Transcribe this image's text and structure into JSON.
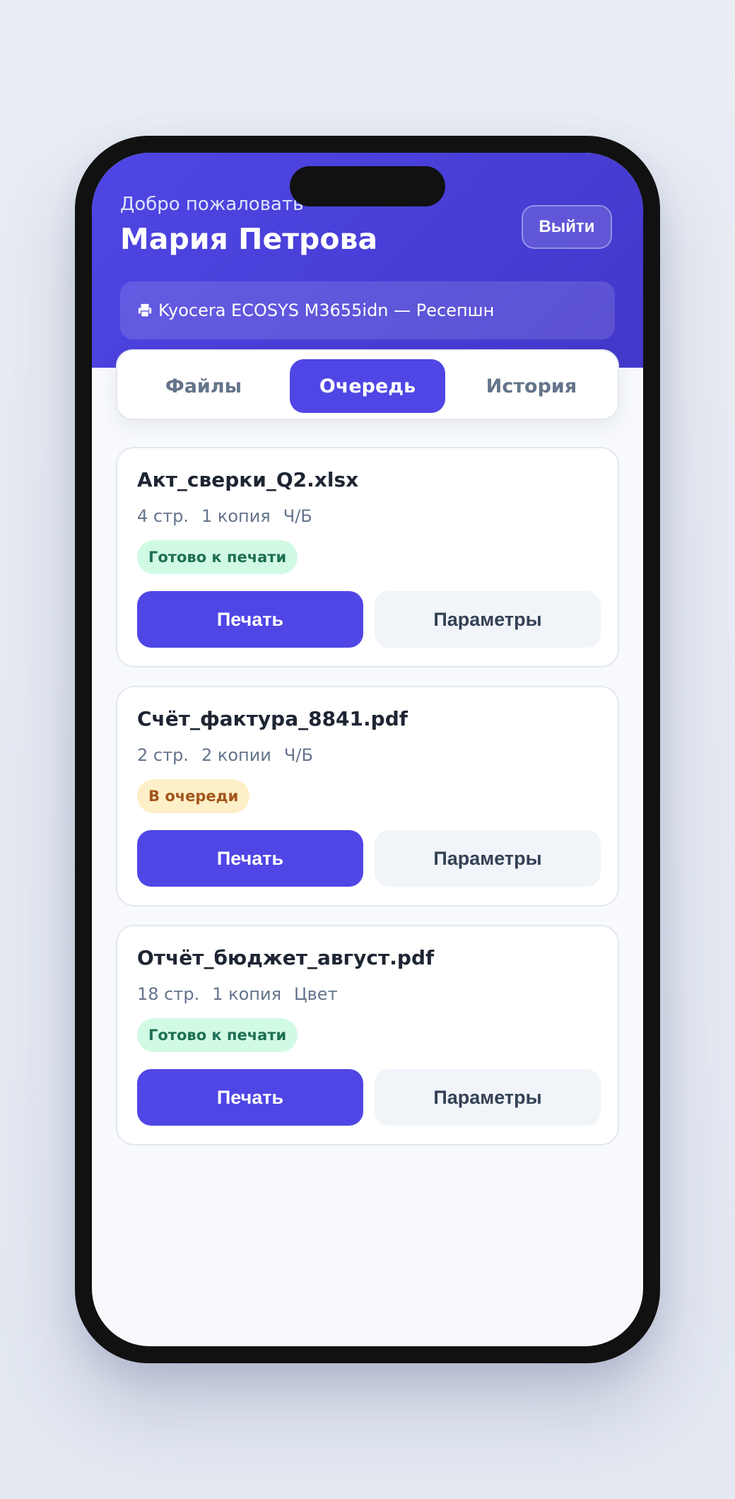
{
  "header": {
    "welcome": "Добро пожаловать",
    "user_name": "Мария Петрова",
    "logout_label": "Выйти",
    "printer_icon": "printer-icon",
    "printer": "Kyocera ECOSYS M3655idn — Ресепшн"
  },
  "tabs": [
    {
      "label": "Файлы",
      "active": false
    },
    {
      "label": "Очередь",
      "active": true
    },
    {
      "label": "История",
      "active": false
    }
  ],
  "jobs": [
    {
      "name": "Акт_сверки_Q2.xlsx",
      "pages": "4 стр.",
      "copies": "1 копия",
      "color": "Ч/Б",
      "status": "Готово к печати",
      "status_type": "ready",
      "print_label": "Печать",
      "settings_label": "Параметры"
    },
    {
      "name": "Счёт_фактура_8841.pdf",
      "pages": "2 стр.",
      "copies": "2 копии",
      "color": "Ч/Б",
      "status": "В очереди",
      "status_type": "queued",
      "print_label": "Печать",
      "settings_label": "Параметры"
    },
    {
      "name": "Отчёт_бюджет_август.pdf",
      "pages": "18 стр.",
      "copies": "1 копия",
      "color": "Цвет",
      "status": "Готово к печати",
      "status_type": "ready",
      "print_label": "Печать",
      "settings_label": "Параметры"
    }
  ],
  "colors": {
    "accent": "#4f46e5",
    "ready_bg": "#d1fae5",
    "ready_text": "#1f6f54",
    "queued_bg": "#fdefc7",
    "queued_text": "#a3561d"
  }
}
